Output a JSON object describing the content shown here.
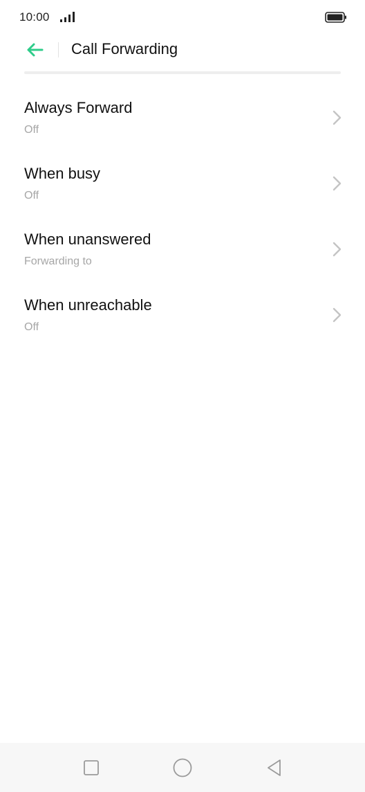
{
  "status_bar": {
    "time": "10:00",
    "icons": [
      "signal-icon",
      "battery-icon"
    ]
  },
  "header": {
    "title": "Call Forwarding",
    "back_icon": "arrow-left-icon"
  },
  "colors": {
    "accent": "#2ecc8a",
    "title_text": "#111111",
    "subtitle_text": "#a6a6a6",
    "chevron": "#c4c4c4",
    "nav_bar_bg": "#f7f7f7"
  },
  "items": [
    {
      "title": "Always Forward",
      "subtitle": "Off"
    },
    {
      "title": "When busy",
      "subtitle": "Off"
    },
    {
      "title": "When unanswered",
      "subtitle": "Forwarding to"
    },
    {
      "title": "When unreachable",
      "subtitle": "Off"
    }
  ],
  "nav_bar": {
    "icons": [
      "square-icon",
      "circle-icon",
      "triangle-back-icon"
    ]
  }
}
